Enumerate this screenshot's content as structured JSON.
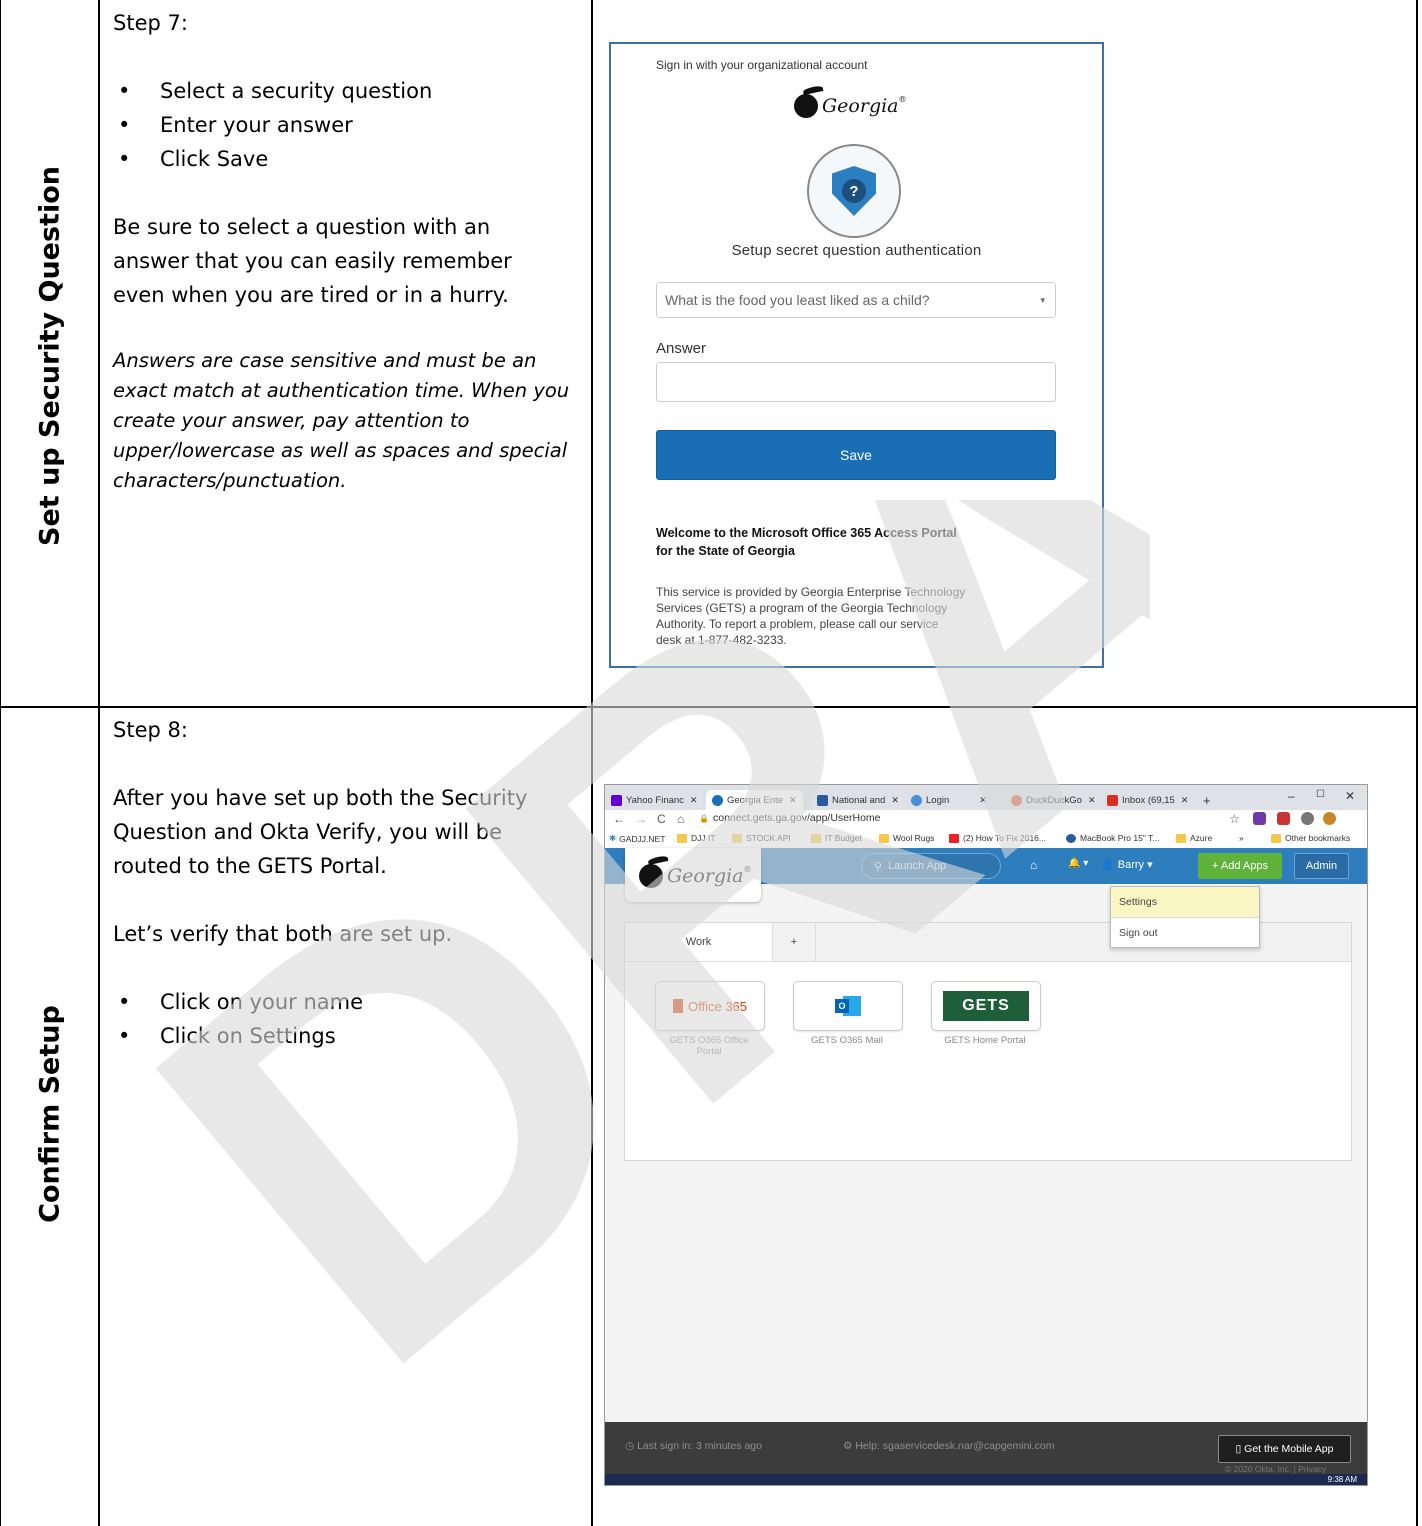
{
  "row1": {
    "heading": "Set up Security Question",
    "step": "Step 7:",
    "bullets": [
      "Select a security question",
      "Enter your answer",
      "Click Save"
    ],
    "tip_lines": [
      "Be sure to select a question with an",
      "answer that you can easily remember",
      "even when you are tired or in a hurry."
    ],
    "note_lines": [
      "Answers are case sensitive and must be an",
      "exact match at authentication time. When you",
      "create your answer, pay attention to",
      "upper/lowercase as well as spaces and special",
      "characters/punctuation."
    ],
    "signin": {
      "org_text": "Sign in with your organizational account",
      "logo_word": "Georgia",
      "logo_reg": "®",
      "shield_glyph": "?",
      "title": "Setup secret question authentication",
      "select_value": "What is the food you least liked as a child?",
      "select_caret": "▾",
      "answer_label": "Answer",
      "answer_value": "",
      "save_label": "Save",
      "welcome_lines": [
        "Welcome to the Microsoft Office 365 Access Portal",
        "for the State of Georgia"
      ],
      "service_lines": [
        "This service is provided by Georgia Enterprise Technology",
        "Services (GETS) a program of the Georgia Technology",
        "Authority. To report a problem, please call our service",
        "desk at 1-877-482-3233."
      ]
    }
  },
  "row2": {
    "heading": "Confirm Setup",
    "step": "Step 8:",
    "para1_lines": [
      "After you have set up both the Security",
      "Question and Okta Verify, you will be",
      "routed to the GETS Portal."
    ],
    "para2": "Let’s verify that both are set up.",
    "bullets": [
      "Click on your name",
      "Click on Settings"
    ],
    "browser": {
      "tabs": [
        {
          "label": "Yahoo Financ",
          "color": "#6001d2"
        },
        {
          "label": "Georgia Ente",
          "color": "#1a6fb4"
        },
        {
          "label": "National and",
          "color": "#2a5aa0"
        },
        {
          "label": "Login",
          "color": "#4a8fd8"
        },
        {
          "label": "DuckDuckGo",
          "color": "#de5833"
        },
        {
          "label": "Inbox (69,15",
          "color": "#d93025"
        }
      ],
      "new_tab": "+",
      "window_controls": [
        "–",
        "☐",
        "✕"
      ],
      "nav_glyphs": [
        "←",
        "→",
        "C",
        "⌂"
      ],
      "url": "connect.gets.ga.gov/app/UserHome",
      "lock": "🔒",
      "star": "☆",
      "bookmarks": [
        "GADJJ.NET",
        "DJJ IT",
        "STOCK API",
        "IT Budget",
        "Wool Rugs",
        "(2) How To Fix 2016...",
        "MacBook Pro 15\" T...",
        "Azure",
        "»",
        "Other bookmarks"
      ],
      "launch_app": "Launch App",
      "search_glyph": "⚲",
      "home_glyph": "⌂",
      "bell_glyph": "🔔 ▾",
      "user_name": "👤 Barry ▾",
      "add_apps": "+ Add Apps",
      "admin": "Admin",
      "dropdown": [
        "Settings",
        "Sign out"
      ],
      "work_tab": "Work",
      "add_tab": "+",
      "apps": [
        {
          "name_lines": [
            "GETS O365 Office",
            "Portal"
          ],
          "logo_text": "Office 365"
        },
        {
          "name_lines": [
            "GETS O365 Mail"
          ],
          "logo_text": "O"
        },
        {
          "name_lines": [
            "GETS Home Portal"
          ],
          "logo_text": "GETS"
        }
      ],
      "last_sign_in": "◷  Last sign in: 3 minutes ago",
      "help": "⚙  Help: sgaservicedesk.nar@capgemini.com",
      "mobile_app": "▯  Get the Mobile App",
      "copyright": "© 2020 Okta, Inc.  |  Privacy",
      "clock": "9:38 AM"
    }
  },
  "watermark_text": "DRAFT"
}
